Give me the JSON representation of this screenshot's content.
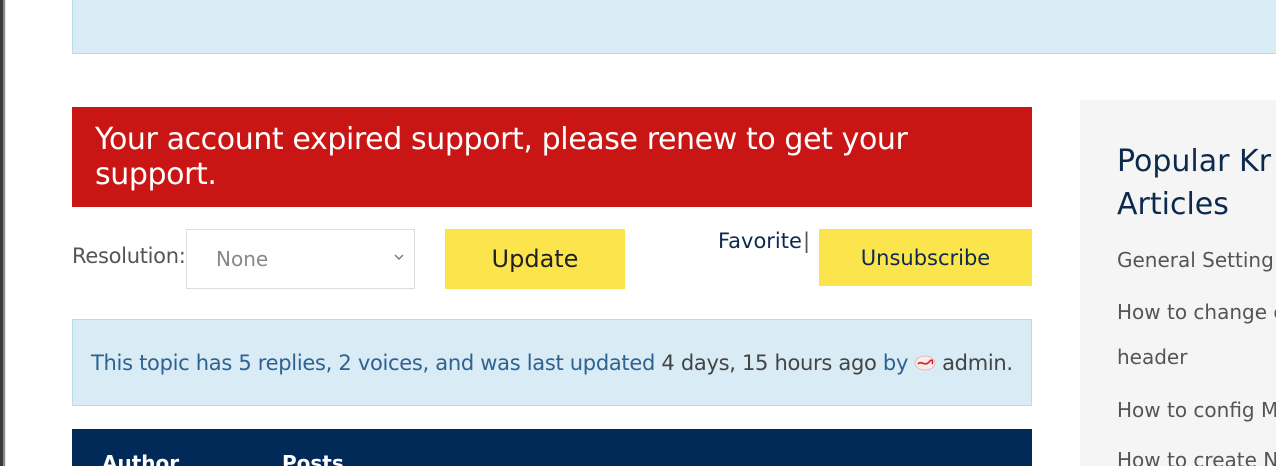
{
  "alert": {
    "text": "Your account expired support, please renew to get your support."
  },
  "resolution": {
    "label": "Resolution:",
    "selected": "None"
  },
  "buttons": {
    "update": "Update",
    "favorite": "Favorite",
    "separator": "|",
    "unsubscribe": "Unsubscribe"
  },
  "topic_info": {
    "part1": "This topic has 5 replies, 2 voices, and was last updated",
    "time": "4 days, 15 hours ago",
    "by": "by",
    "author": "admin."
  },
  "table": {
    "columns": [
      "Author",
      "Posts"
    ]
  },
  "sidebar": {
    "title_line1": "Popular Kr",
    "title_line2": "Articles",
    "items": [
      "General Setting",
      "How to change c",
      "header",
      "How to config M",
      "How to create N"
    ]
  },
  "colors": {
    "alert_bg": "#ca1515",
    "button_yellow": "#fbe44c",
    "navy": "#012a58",
    "info_bg": "#d9ebf5"
  }
}
